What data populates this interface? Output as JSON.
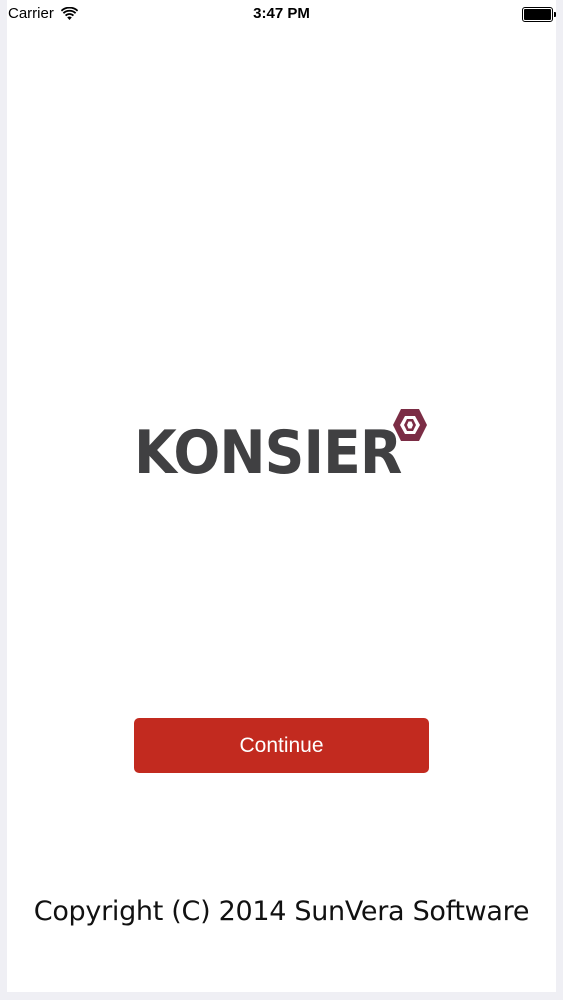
{
  "status_bar": {
    "carrier": "Carrier",
    "time": "3:47 PM",
    "wifi_icon": "wifi-icon",
    "battery_icon": "battery-icon",
    "battery_level": 1.0
  },
  "logo": {
    "text": "KONSIER",
    "mark_icon": "hexagon-icon",
    "mark_color": "#7b2d45",
    "text_color": "#404042"
  },
  "continue_button": {
    "label": "Continue",
    "color": "#c22a1f"
  },
  "footer": {
    "copyright": "Copyright (C) 2014 SunVera Software"
  }
}
